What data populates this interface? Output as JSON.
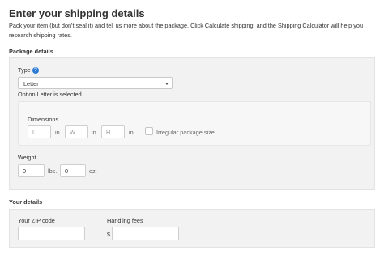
{
  "page": {
    "title": "Enter your shipping details",
    "intro": "Pack your item (but don't seal it) and tell us more about the package. Click Calculate shipping, and the Shipping Calculator will help you research shipping rates."
  },
  "package": {
    "section_title": "Package details",
    "type_label": "Type",
    "type_help_icon": "help-icon",
    "type_help_glyph": "?",
    "type_value": "Letter",
    "type_status": "Option Letter is selected",
    "dimensions_label": "Dimensions",
    "length_placeholder": "L",
    "length_unit": "in.",
    "width_placeholder": "W",
    "width_unit": "in.",
    "height_placeholder": "H",
    "height_unit": "in.",
    "irregular_label": "Irregular package size",
    "irregular_checked": false,
    "weight_label": "Weight",
    "weight_lbs_value": "0",
    "weight_lbs_unit": "lbs.",
    "weight_oz_value": "0",
    "weight_oz_unit": "oz."
  },
  "your_details": {
    "section_title": "Your details",
    "zip_label": "Your ZIP code",
    "zip_value": "",
    "handling_label": "Handling fees",
    "currency_symbol": "$",
    "handling_value": ""
  },
  "colors": {
    "accent": "#2b7bd4",
    "panel_bg": "#f2f2f2"
  }
}
